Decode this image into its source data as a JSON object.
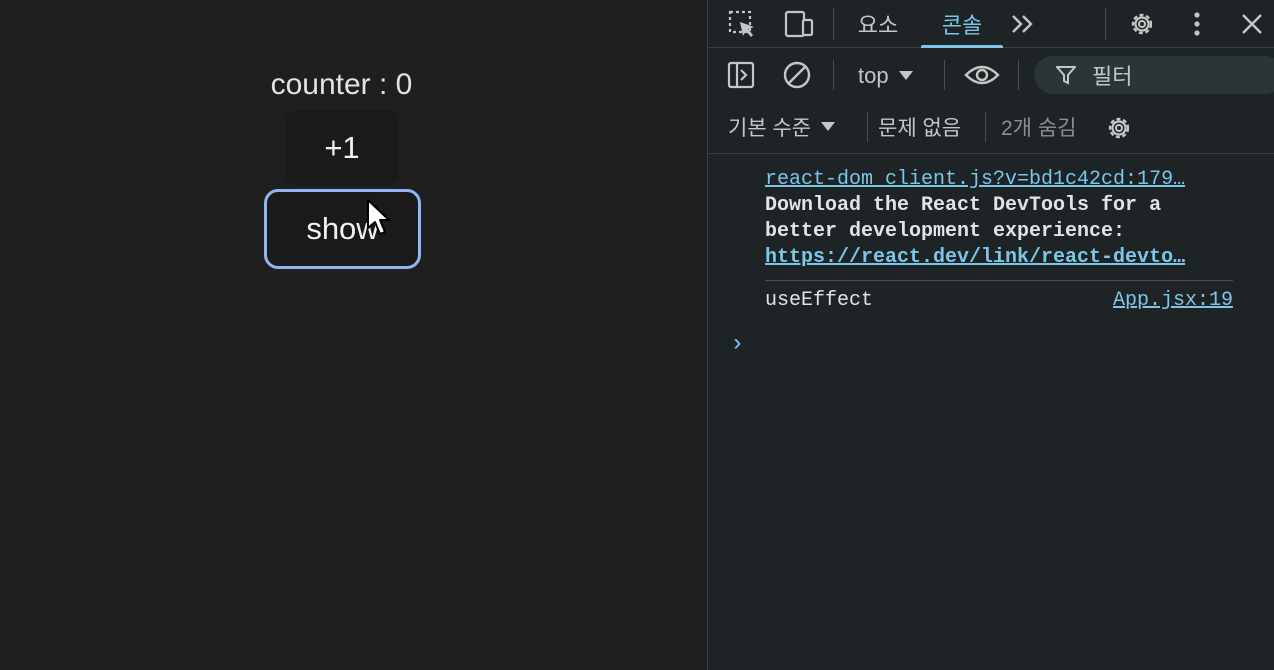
{
  "app": {
    "counter_text": "counter : 0",
    "increment_label": "+1",
    "show_label": "show"
  },
  "devtools": {
    "tabs": [
      {
        "label": "요소",
        "active": false
      },
      {
        "label": "콘솔",
        "active": true
      }
    ],
    "context": "top",
    "filter_placeholder": "필터",
    "log_levels": "기본 수준",
    "issues": "문제 없음",
    "hidden": "2개 숨김",
    "messages": [
      {
        "source": "react-dom_client.js?v=bd1c42cd:179…",
        "text_line1": "Download the React DevTools for a",
        "text_line2": "better development experience:",
        "link": "https://react.dev/link/react-devto…"
      },
      {
        "text": "useEffect",
        "source": "App.jsx:19"
      }
    ],
    "prompt_symbol": "›"
  },
  "colors": {
    "page_bg": "#1f1f1f",
    "devtools_bg": "#1e2326",
    "accent": "#7cc7e8",
    "focus_ring": "#93b4f0"
  }
}
